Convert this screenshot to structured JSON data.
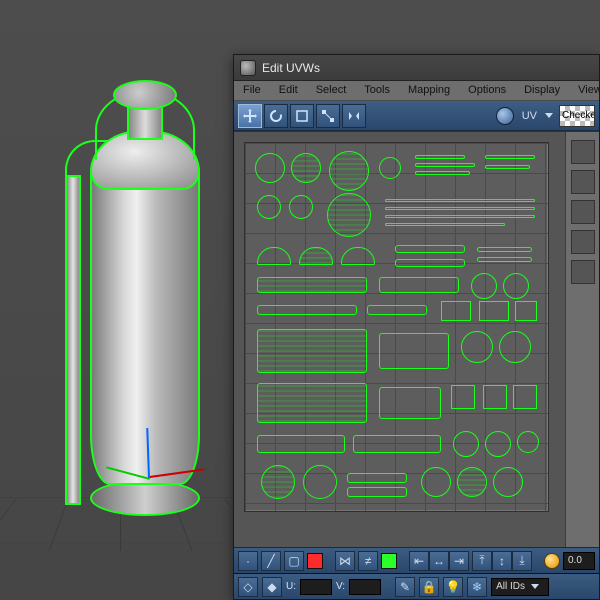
{
  "window": {
    "title": "Edit UVWs"
  },
  "menus": {
    "file": "File",
    "edit": "Edit",
    "select": "Select",
    "tools": "Tools",
    "mapping": "Mapping",
    "options": "Options",
    "display": "Display",
    "view": "View"
  },
  "toolbar_top": {
    "uv_label": "UV",
    "checker_label": "Checker"
  },
  "toolbar_bottom": {
    "spinner_value": "0.0"
  },
  "statusbar": {
    "u_label": "U:",
    "v_label": "V:",
    "u_value": "",
    "v_value": "",
    "ids_label": "All IDs"
  }
}
